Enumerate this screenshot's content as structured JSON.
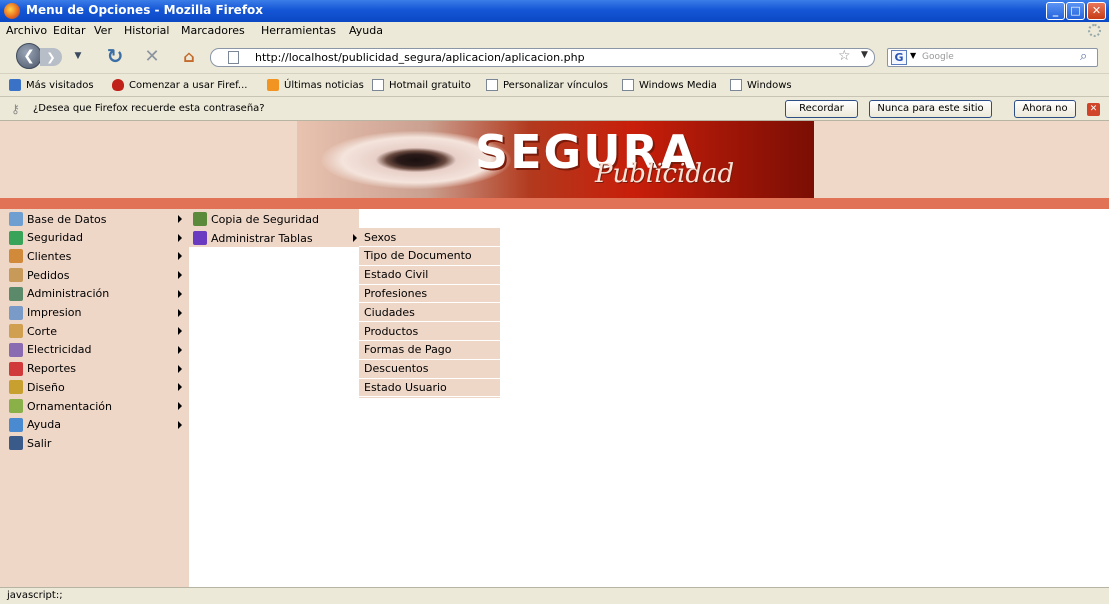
{
  "window": {
    "title": "Menu de Opciones - Mozilla Firefox"
  },
  "menubar": [
    "Archivo",
    "Editar",
    "Ver",
    "Historial",
    "Marcadores",
    "Herramientas",
    "Ayuda"
  ],
  "navbar": {
    "url": "http://localhost/publicidad_segura/aplicacion/aplicacion.php",
    "search_placeholder": "Google",
    "search_engine_icon": "G"
  },
  "bookmarks": [
    {
      "label": "Más visitados",
      "icon": "blue"
    },
    {
      "label": "Comenzar a usar Firef...",
      "icon": "red"
    },
    {
      "label": "Últimas noticias",
      "icon": "rss"
    },
    {
      "label": "Hotmail gratuito",
      "icon": "page"
    },
    {
      "label": "Personalizar vínculos",
      "icon": "page"
    },
    {
      "label": "Windows Media",
      "icon": "page"
    },
    {
      "label": "Windows",
      "icon": "page"
    }
  ],
  "password_bar": {
    "message": "¿Desea que Firefox recuerde esta contraseña?",
    "remember": "Recordar",
    "never": "Nunca para este sitio",
    "not_now": "Ahora no"
  },
  "banner": {
    "brand": "SEGURA",
    "brand_sub": "Publicidad"
  },
  "menu": [
    {
      "label": "Base de Datos",
      "icon": "database-icon",
      "color": "#6f9fd0",
      "arrow": true
    },
    {
      "label": "Seguridad",
      "icon": "security-icon",
      "color": "#3aa35a",
      "arrow": true
    },
    {
      "label": "Clientes",
      "icon": "clients-icon",
      "color": "#d08a3a",
      "arrow": true
    },
    {
      "label": "Pedidos",
      "icon": "orders-icon",
      "color": "#c89a5a",
      "arrow": true
    },
    {
      "label": "Administración",
      "icon": "admin-icon",
      "color": "#5a8a6a",
      "arrow": true
    },
    {
      "label": "Impresion",
      "icon": "print-icon",
      "color": "#7a9ac8",
      "arrow": true
    },
    {
      "label": "Corte",
      "icon": "cut-icon",
      "color": "#d0a050",
      "arrow": true
    },
    {
      "label": "Electricidad",
      "icon": "electricity-icon",
      "color": "#8a6ab0",
      "arrow": true
    },
    {
      "label": "Reportes",
      "icon": "reports-icon",
      "color": "#d03a3a",
      "arrow": true
    },
    {
      "label": "Diseño",
      "icon": "design-icon",
      "color": "#c8a030",
      "arrow": true
    },
    {
      "label": "Ornamentación",
      "icon": "ornament-icon",
      "color": "#8ab04a",
      "arrow": true
    },
    {
      "label": "Ayuda",
      "icon": "help-icon",
      "color": "#4a8ad0",
      "arrow": true
    },
    {
      "label": "Salir",
      "icon": "exit-icon",
      "color": "#3a5a8a",
      "arrow": false
    }
  ],
  "submenu_seguridad": [
    {
      "label": "Copia de Seguridad",
      "icon": "backup-icon",
      "color": "#5a8a3a",
      "arrow": false
    },
    {
      "label": "Administrar Tablas",
      "icon": "tables-icon",
      "color": "#6a3ac0",
      "arrow": true
    }
  ],
  "submenu_tablas": [
    "Sexos",
    "Tipo de Documento",
    "Estado Civil",
    "Profesiones",
    "Ciudades",
    "Productos",
    "Formas de Pago",
    "Descuentos",
    "Estado Usuario"
  ],
  "status": "javascript:;"
}
